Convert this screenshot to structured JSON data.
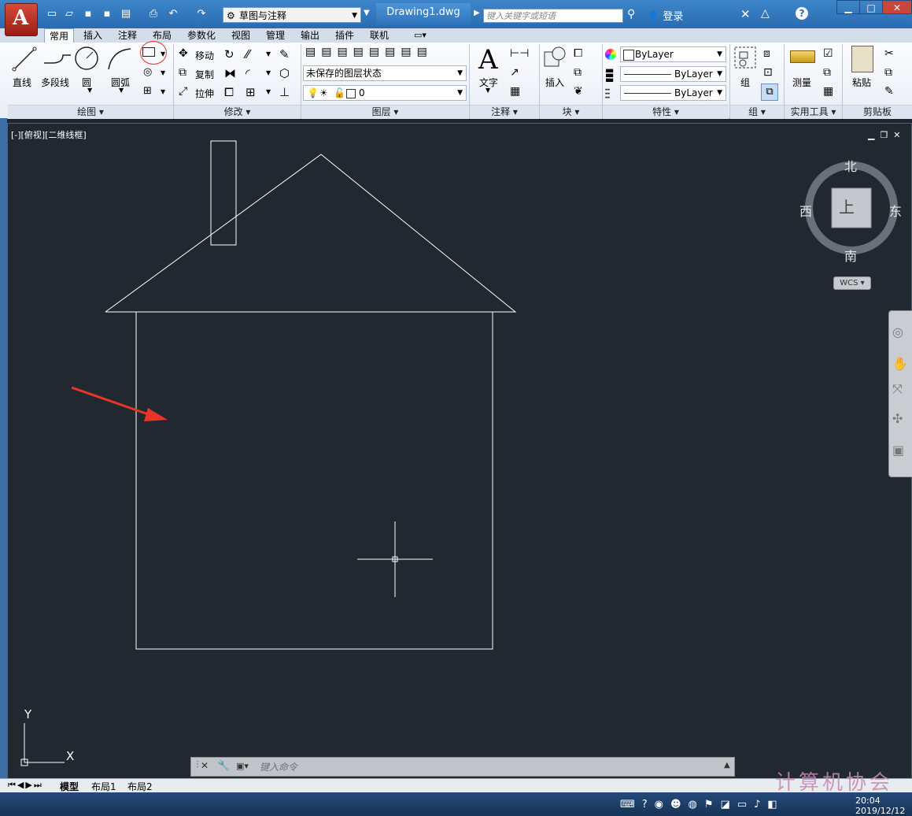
{
  "app": {
    "document_title": "Drawing1.dwg",
    "workspace": "草图与注释",
    "search_placeholder": "键入关键字或短语",
    "login": "登录"
  },
  "ribbon_tabs": [
    "常用",
    "插入",
    "注释",
    "布局",
    "参数化",
    "视图",
    "管理",
    "输出",
    "插件",
    "联机"
  ],
  "ribbon": {
    "draw": {
      "title": "绘图",
      "tools": [
        "直线",
        "多段线",
        "圆",
        "圆弧"
      ]
    },
    "modify": {
      "title": "修改",
      "tools": [
        "移动",
        "复制",
        "拉伸"
      ]
    },
    "layers": {
      "title": "图层",
      "state": "未保存的图层状态",
      "current_layer": "0"
    },
    "annotation": {
      "title": "注释",
      "text": "文字"
    },
    "block": {
      "title": "块",
      "insert": "插入"
    },
    "properties": {
      "title": "特性",
      "color": "ByLayer",
      "linetype": "ByLayer",
      "lineweight": "ByLayer"
    },
    "group": {
      "title": "组",
      "group": "组"
    },
    "utilities": {
      "title": "实用工具",
      "measure": "测量"
    },
    "clipboard": {
      "title": "剪贴板",
      "paste": "粘贴"
    }
  },
  "viewport": {
    "label": "[-][俯视][二维线框]",
    "compass": {
      "north": "北",
      "south": "南",
      "east": "东",
      "west": "西",
      "top": "上"
    },
    "wcs": "WCS",
    "ucs_x": "X",
    "ucs_y": "Y"
  },
  "command_line": {
    "placeholder": "键入命令"
  },
  "layout_tabs": [
    "模型",
    "布局1",
    "布局2"
  ],
  "taskbar": {
    "time": "20:04",
    "date": "2019/12/12"
  },
  "watermark": "计算机协会",
  "colors": {
    "canvas": "#212830",
    "drawing_lines": "#ffffff",
    "arrow": "#e8352a",
    "highlight_circle": "#e8352a"
  }
}
